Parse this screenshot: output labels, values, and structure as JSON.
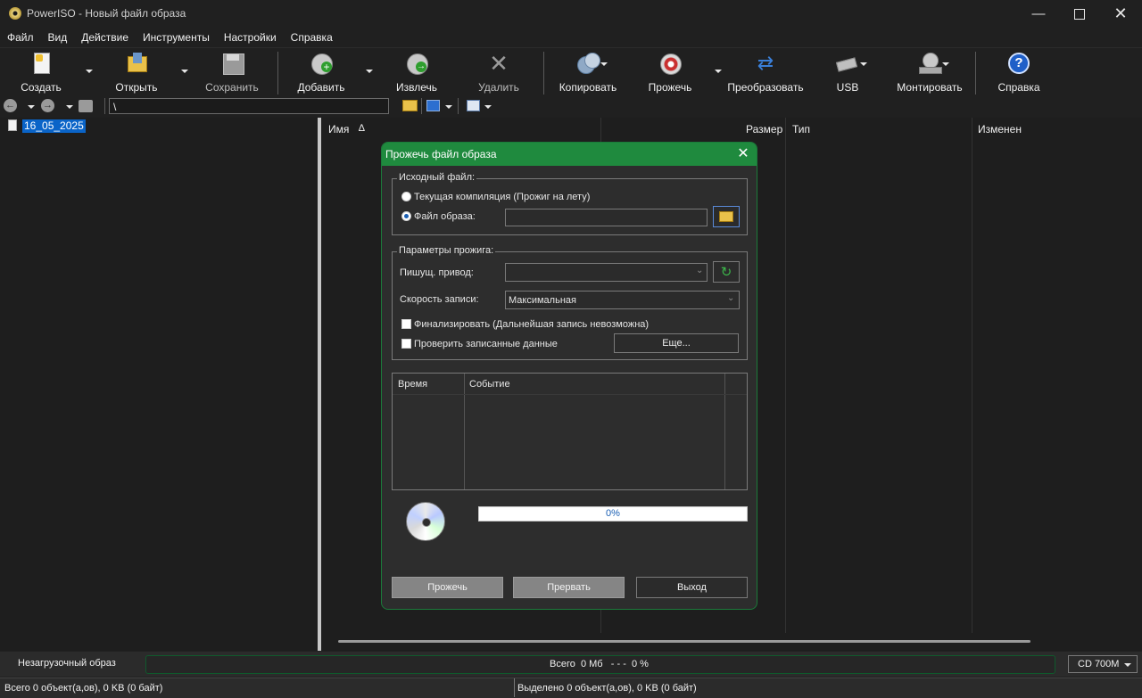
{
  "window": {
    "title": "PowerISO - Новый файл образа"
  },
  "menu": [
    "Файл",
    "Вид",
    "Действие",
    "Инструменты",
    "Настройки",
    "Справка"
  ],
  "toolbar": {
    "create": "Создать",
    "open": "Открыть",
    "save": "Сохранить",
    "add": "Добавить",
    "extract": "Извлечь",
    "delete": "Удалить",
    "copy": "Копировать",
    "burn": "Прожечь",
    "convert": "Преобразовать",
    "usb": "USB",
    "mount": "Монтировать",
    "help": "Справка"
  },
  "address": {
    "path": "\\"
  },
  "tree": {
    "root": "16_05_2025"
  },
  "columns": {
    "name": "Имя",
    "sort_indicator": "∆",
    "size": "Размер",
    "type": "Тип",
    "modified": "Изменен"
  },
  "status": {
    "boot": "Незагрузочный образ",
    "total": "Всего  0 Мб   - - -  0 %",
    "media": "CD 700M",
    "objects": "Всего 0 объект(а,ов), 0 KB (0 байт)",
    "selected": "Выделено 0 объект(а,ов), 0 KB (0 байт)"
  },
  "dialog": {
    "title": "Прожечь файл образа",
    "source_legend": "Исходный файл:",
    "radio_current": "Текущая компиляция (Прожиг на лету)",
    "radio_image": "Файл образа:",
    "image_path": "",
    "params_legend": "Параметры прожига:",
    "drive_label": "Пишущ. привод:",
    "drive_value": "",
    "speed_label": "Скорость записи:",
    "speed_value": "Максимальная",
    "finalize": "Финализировать (Дальнейшая запись невозможна)",
    "verify": "Проверить записанные данные",
    "more": "Еще...",
    "log_col_time": "Время",
    "log_col_event": "Событие",
    "progress_text": "0%",
    "progress_value": 0,
    "burn": "Прожечь",
    "abort": "Прервать",
    "exit": "Выход"
  },
  "colors": {
    "dialog_title": "#1f8a3e",
    "selection": "#0a64c8"
  }
}
